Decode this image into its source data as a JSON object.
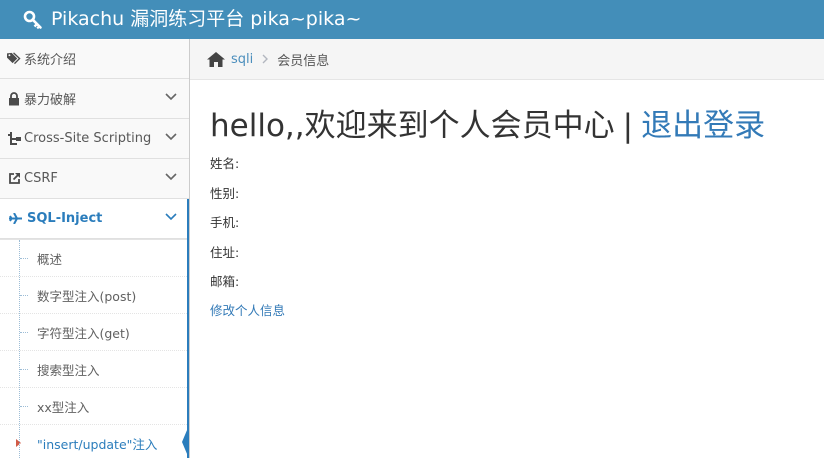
{
  "header": {
    "brand": "Pikachu 漏洞练习平台 pika~pika~"
  },
  "sidebar": {
    "items": [
      {
        "label": "系统介绍",
        "icon": "tags-icon"
      },
      {
        "label": "暴力破解",
        "icon": "lock-icon"
      },
      {
        "label": "Cross-Site Scripting",
        "icon": "tree-icon"
      },
      {
        "label": "CSRF",
        "icon": "external-link-icon"
      },
      {
        "label": "SQL-Inject",
        "icon": "plane-icon"
      }
    ],
    "sub_items": [
      "概述",
      "数字型注入(post)",
      "字符型注入(get)",
      "搜索型注入",
      "xx型注入",
      "\"insert/update\"注入"
    ]
  },
  "breadcrumb": {
    "link": "sqli",
    "current": "会员信息"
  },
  "main": {
    "greeting": "hello,,欢迎来到个人会员中心",
    "separator": "|",
    "logout": "退出登录",
    "fields": [
      "姓名:",
      "性别:",
      "手机:",
      "住址:",
      "邮箱:"
    ],
    "edit_link": "修改个人信息"
  },
  "colors": {
    "navbar": "#438eb9",
    "link": "#337ab7",
    "active": "#2b7dbc",
    "caret": "#d15b47"
  }
}
